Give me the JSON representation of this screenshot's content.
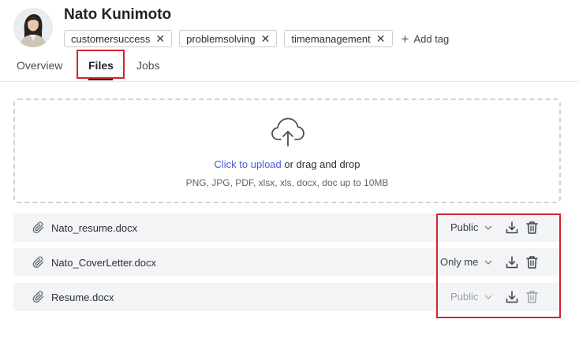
{
  "profile": {
    "name": "Nato Kunimoto",
    "tags": [
      "customersuccess",
      "problemsolving",
      "timemanagement"
    ],
    "add_tag_label": "Add tag"
  },
  "tabs": [
    {
      "label": "Overview",
      "active": false
    },
    {
      "label": "Files",
      "active": true
    },
    {
      "label": "Jobs",
      "active": false
    }
  ],
  "upload": {
    "link_text": "Click to upload",
    "rest_text": " or drag and drop",
    "hint": "PNG, JPG, PDF, xlsx, xls, docx, doc up to 10MB"
  },
  "files": [
    {
      "name": "Nato_resume.docx",
      "permission": "Public",
      "disabled": false
    },
    {
      "name": "Nato_CoverLetter.docx",
      "permission": "Only me",
      "disabled": false
    },
    {
      "name": "Resume.docx",
      "permission": "Public",
      "disabled": true
    }
  ],
  "colors": {
    "accent_link": "#4b5bd6",
    "highlight_box": "#d0262d",
    "row_bg": "#f3f4f6"
  }
}
